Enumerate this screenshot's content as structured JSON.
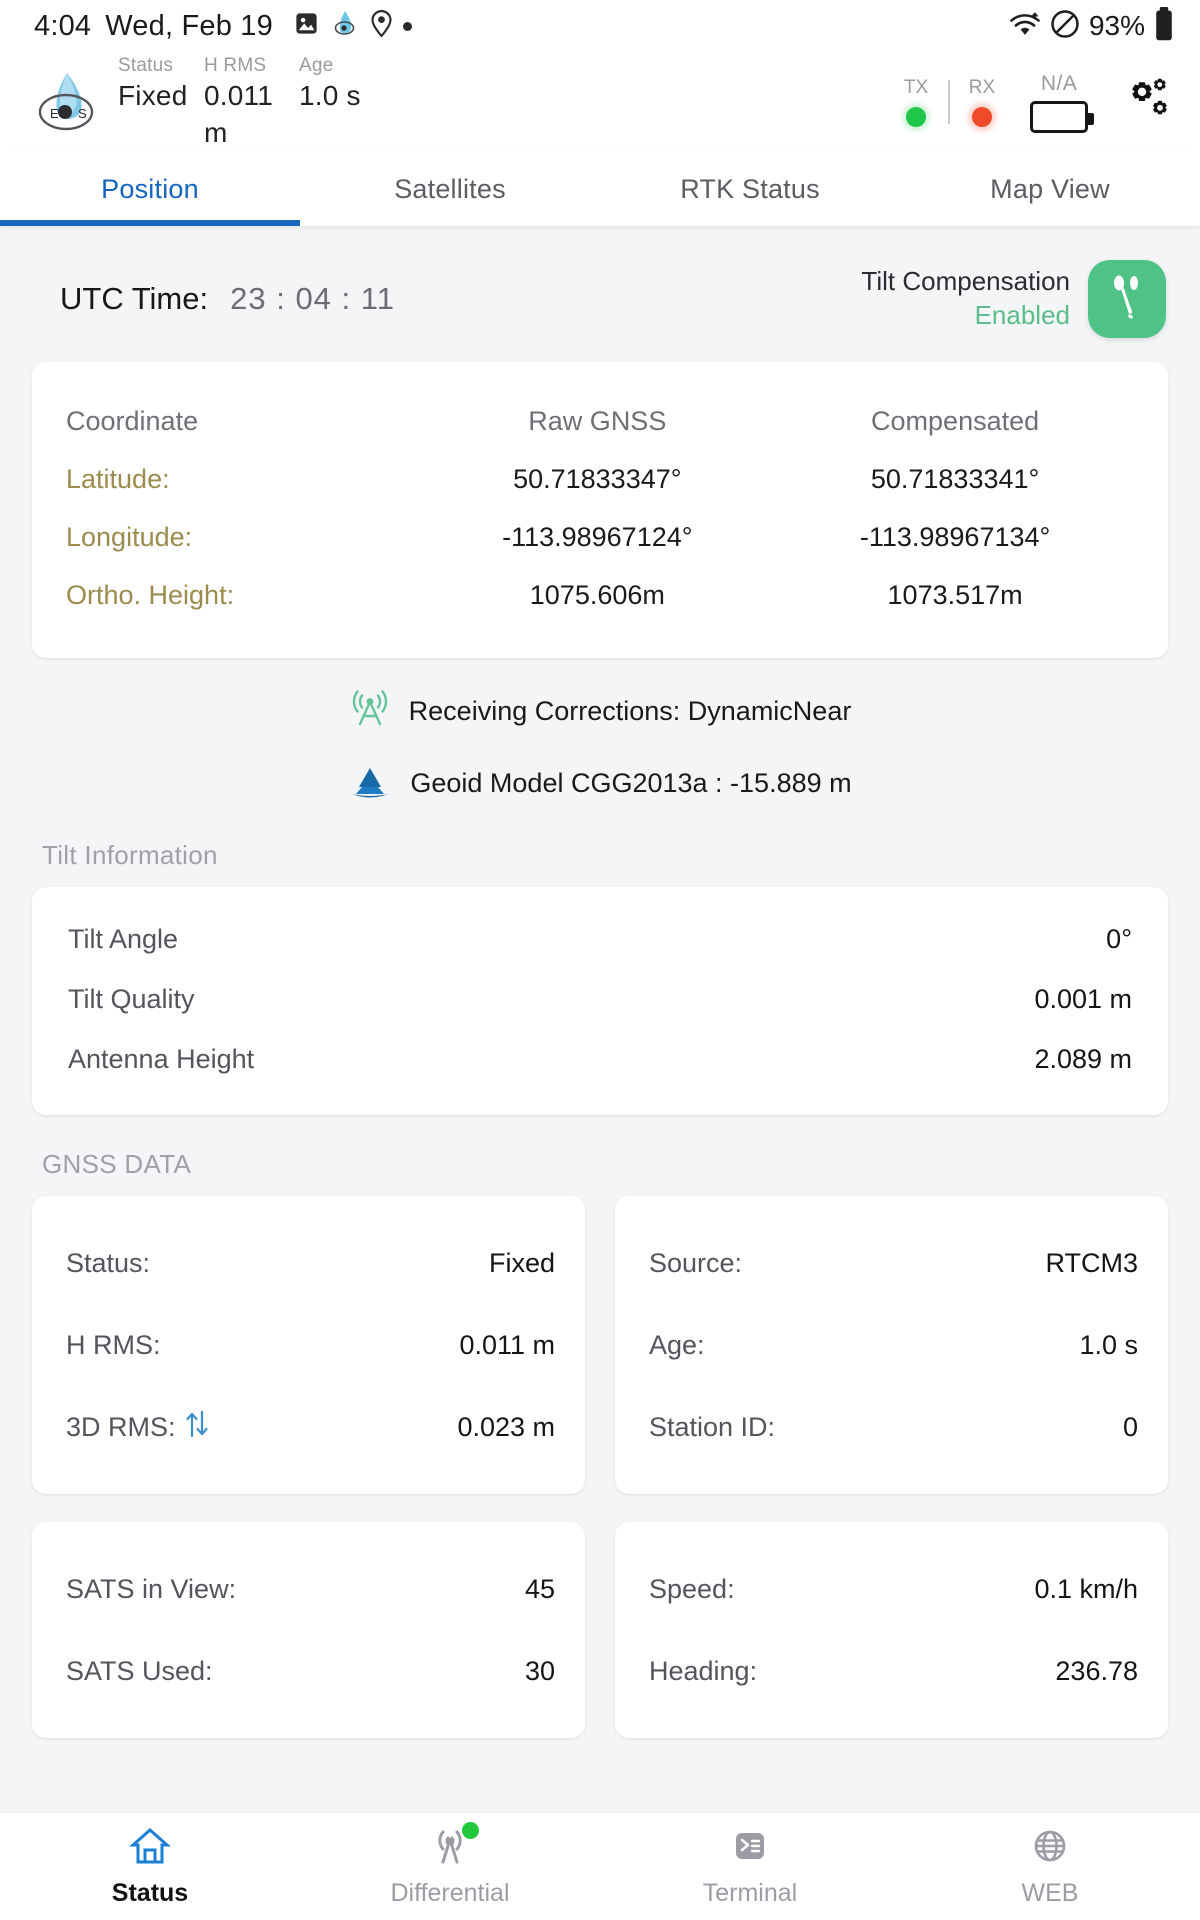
{
  "status_bar": {
    "time": "4:04",
    "date": "Wed, Feb 19",
    "battery_percent": "93%",
    "icons": [
      "image-icon",
      "app-icon",
      "location-pin-icon",
      "dot-icon",
      "wifi-icon",
      "do-not-disturb-icon"
    ]
  },
  "app_header": {
    "logo": "eos-logo",
    "kpis": [
      {
        "label": "Status",
        "value": "Fixed"
      },
      {
        "label": "H RMS",
        "value": "0.011 m"
      },
      {
        "label": "Age",
        "value": "1.0 s"
      }
    ],
    "tx_label": "TX",
    "rx_label": "RX",
    "tx_color": "#1fc74a",
    "rx_color": "#f04b28",
    "battery_label": "N/A",
    "settings_icon": "gears-icon"
  },
  "tabs": [
    {
      "label": "Position",
      "active": true
    },
    {
      "label": "Satellites",
      "active": false
    },
    {
      "label": "RTK Status",
      "active": false
    },
    {
      "label": "Map View",
      "active": false
    }
  ],
  "position": {
    "utc_label": "UTC Time:",
    "utc_value": "23 : 04 : 11",
    "tilt_compensation_title": "Tilt Compensation",
    "tilt_compensation_state": "Enabled",
    "tilt_accent": "#4fc285",
    "coordinates": {
      "headers": [
        "Coordinate",
        "Raw GNSS",
        "Compensated"
      ],
      "rows": [
        {
          "key": "Latitude:",
          "raw": "50.71833347°",
          "compensated": "50.71833341°"
        },
        {
          "key": "Longitude:",
          "raw": "-113.98967124°",
          "compensated": "-113.98967134°"
        },
        {
          "key": "Ortho. Height:",
          "raw": "1075.606m",
          "compensated": "1073.517m"
        }
      ]
    },
    "corrections_text": "Receiving Corrections: DynamicNear",
    "corrections_icon": "antenna-broadcast-icon",
    "geoid_text": "Geoid Model CGG2013a : -15.889 m",
    "geoid_icon": "mountain-icon"
  },
  "tilt_information": {
    "section_title": "Tilt Information",
    "rows": [
      {
        "key": "Tilt Angle",
        "value": "0°"
      },
      {
        "key": "Tilt Quality",
        "value": "0.001 m"
      },
      {
        "key": "Antenna Height",
        "value": "2.089 m"
      }
    ]
  },
  "gnss_data": {
    "section_title": "GNSS DATA",
    "card_left_top": [
      {
        "key": "Status:",
        "value": "Fixed"
      },
      {
        "key": "H RMS:",
        "value": "0.011 m"
      },
      {
        "key": "3D RMS:",
        "value": "0.023 m",
        "icon": "up-down-arrows-icon"
      }
    ],
    "card_right_top": [
      {
        "key": "Source:",
        "value": "RTCM3"
      },
      {
        "key": "Age:",
        "value": "1.0 s"
      },
      {
        "key": "Station ID:",
        "value": "0"
      }
    ],
    "card_left_bottom": [
      {
        "key": "SATS in View:",
        "value": "45"
      },
      {
        "key": "SATS Used:",
        "value": "30"
      }
    ],
    "card_right_bottom": [
      {
        "key": "Speed:",
        "value": "0.1 km/h"
      },
      {
        "key": "Heading:",
        "value": "236.78"
      }
    ]
  },
  "bottom_nav": [
    {
      "label": "Status",
      "icon": "home-icon",
      "active": true,
      "badge": false
    },
    {
      "label": "Differential",
      "icon": "broadcast-icon",
      "active": false,
      "badge": true
    },
    {
      "label": "Terminal",
      "icon": "terminal-icon",
      "active": false,
      "badge": false
    },
    {
      "label": "WEB",
      "icon": "globe-icon",
      "active": false,
      "badge": false
    }
  ]
}
